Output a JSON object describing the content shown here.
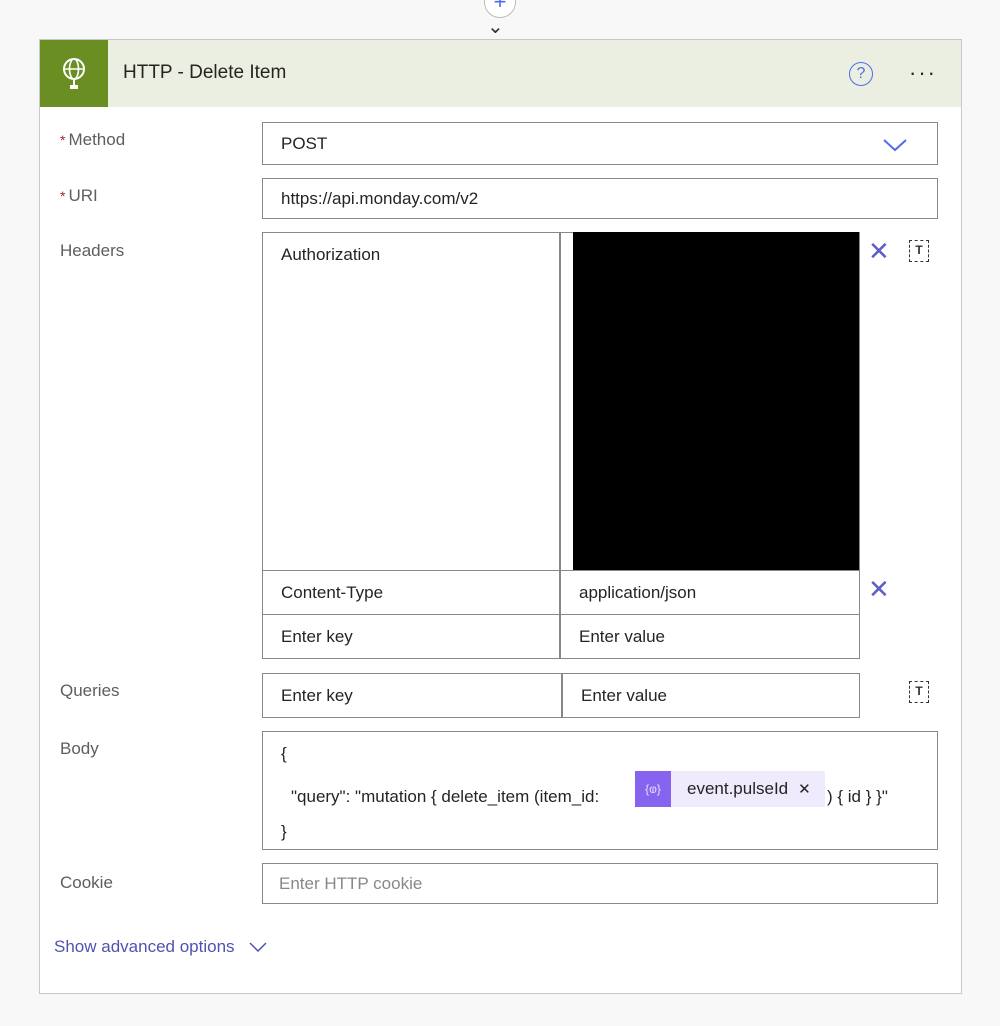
{
  "card": {
    "title": "HTTP - Delete Item"
  },
  "fields": {
    "method": {
      "label": "Method",
      "required": "*",
      "value": "POST"
    },
    "uri": {
      "label": "URI",
      "required": "*",
      "value": "https://api.monday.com/v2"
    },
    "headers": {
      "label": "Headers",
      "rows": [
        {
          "key": "Authorization",
          "value": ""
        },
        {
          "key": "Content-Type",
          "value": "application/json"
        }
      ],
      "key_placeholder": "Enter key",
      "value_placeholder": "Enter value"
    },
    "queries": {
      "label": "Queries",
      "key_placeholder": "Enter key",
      "value_placeholder": "Enter value"
    },
    "body": {
      "label": "Body",
      "line1": "{",
      "line2_prefix": "\"query\": \"mutation { delete_item (item_id:",
      "token": "event.pulseId",
      "line2_suffix": ") { id } }\"",
      "line3": "}"
    },
    "cookie": {
      "label": "Cookie",
      "placeholder": "Enter HTTP cookie"
    }
  },
  "advanced": {
    "label": "Show advanced options"
  },
  "colors": {
    "accent": "#5b5fc7",
    "brand": "#6b8e23",
    "token": "#8764f0"
  }
}
